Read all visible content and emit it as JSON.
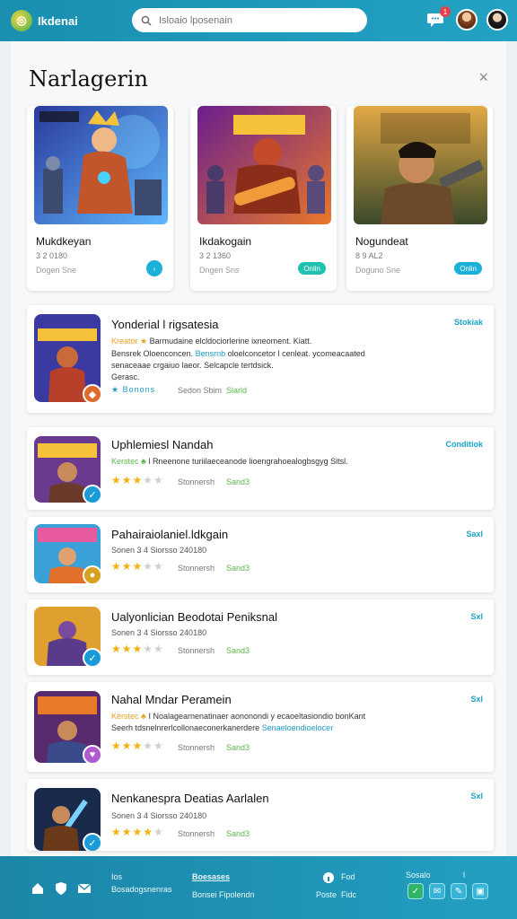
{
  "header": {
    "logo_glyph": "◎",
    "brand": "Ikdenai",
    "search_placeholder": "Isloaio lposenain",
    "notification_count": "1"
  },
  "panel": {
    "title": "Narlagerin",
    "close_glyph": "×"
  },
  "featured": [
    {
      "name": "Mukdkeyan",
      "meta": "3 2 0180",
      "sub": "Dogen Sne",
      "button": "›"
    },
    {
      "name": "Ikdakogain",
      "meta": "3 2 1360",
      "sub": "Dngen Sns",
      "button": "Onlin"
    },
    {
      "name": "Nogundeat",
      "meta": "8 9 AL2",
      "sub": "Doguno Sne",
      "button": "Onlin"
    }
  ],
  "list": [
    {
      "title": "Yonderial l rigsatesia",
      "tag": "Stokiak",
      "cat": "Kreator ★",
      "desc1": "Barmudaine elcldociorlerine ixneoment. Kiatt.",
      "desc2a": "Bensrek Oloenconcen.",
      "desc2b": "Bensrnb",
      "desc2c": "oloelconcetor l cenleat. ycomeacaated",
      "desc3": "senaceaae crgaiuo laeor. Selcapcle tertdsick.",
      "desc4": "Gerasc.",
      "rating_label": "★ Bonons",
      "downloads": "Sedon Sbim",
      "count": "Slarld"
    },
    {
      "title": "Uphlemiesl Nandah",
      "tag": "Conditiok",
      "cat": "Kerstec ♣",
      "desc1": "l Rneenone turiilaeceanode lioengrahoealogbsgyg Sitsl.",
      "stars": "★★★",
      "stars_off": "★★",
      "downloads": "Stonnersh",
      "count": "Sand3"
    },
    {
      "title": "Pahairaiolaniel.ldkgain",
      "tag": "Saxl",
      "cat": "Sonen 3 4 Siorsso 240180",
      "stars": "★★★",
      "stars_off": "★★",
      "downloads": "Stonnersh",
      "count": "Sand3"
    },
    {
      "title": "Ualyonlician Beodotai Peniksnal",
      "tag": "Sxl",
      "cat": "Sonen 3 4 Siorsso 240180",
      "stars": "★★★",
      "stars_off": "★★",
      "downloads": "Stonnersh",
      "count": "Sand3"
    },
    {
      "title": "Nahal Mndar Peramein",
      "tag": "Sxl",
      "cat": "Kerstec ♣",
      "desc1": "I Noalagearnenatinaer aononondi y ecaoeltasiondio bonKant",
      "desc2a": "Seerh tdsnelnrerlcollonaeconerkanerdere",
      "desc2b": "Senaeloendioelocer",
      "stars": "★★★",
      "stars_off": "★★",
      "downloads": "Stonnersh",
      "count": "Sand3"
    },
    {
      "title": "Nenkanespra Deatias Aarlalen",
      "tag": "Sxl",
      "cat": "Sonen 3 4 Siorsso 240180",
      "stars": "★★★★",
      "stars_off": "★",
      "downloads": "Stonnersh",
      "count": "Sand3"
    }
  ],
  "bottombar": {
    "col1a": "Ios",
    "col1b": "Bosadogsnenras",
    "col2a": "Boesases",
    "col2b": "Bonsei Fipolendn",
    "col3a": "Fod",
    "col3b": "Poste",
    "col3c": "Fidc",
    "col4a": "Sosalo",
    "col4b": "l"
  },
  "colors": {
    "accent": "#1a9ac0",
    "topbar": "#1a8fb0",
    "star": "#f2b10b"
  }
}
